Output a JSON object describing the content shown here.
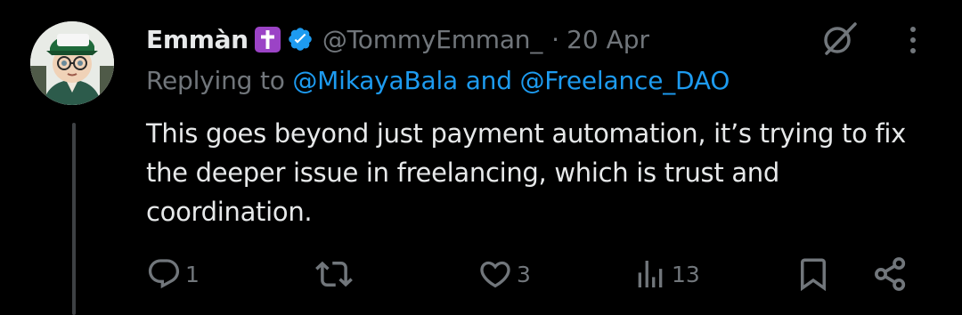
{
  "tweet": {
    "display_name": "Emmàn",
    "handle": "@TommyEmman_",
    "separator": "·",
    "timestamp": "20 Apr",
    "replying_prefix": "Replying to",
    "reply_mention_1": "@MikayaBala",
    "reply_joiner": "and",
    "reply_mention_2": "@Freelance_DAO",
    "text_lines": [
      "This goes beyond just payment automation, it’s trying to fix",
      "the deeper issue in freelancing, which is trust and",
      "coordination."
    ]
  },
  "actions": {
    "replies": "1",
    "reposts": "",
    "likes": "3",
    "views": "13"
  },
  "icons": {
    "name_emoji": "latin-cross-emoji",
    "verified": "verified-badge-icon",
    "grok": "grok-icon",
    "more": "more-vertical-icon",
    "reply": "reply-icon",
    "repost": "repost-icon",
    "like": "heart-icon",
    "views": "views-icon",
    "bookmark": "bookmark-icon",
    "share": "share-icon"
  },
  "colors": {
    "background": "#000000",
    "primary_text": "#e7e9ea",
    "secondary_text": "#71767b",
    "accent": "#1d9bf0",
    "emoji_purple": "#9b43c6",
    "thread_line": "#3e4144"
  }
}
